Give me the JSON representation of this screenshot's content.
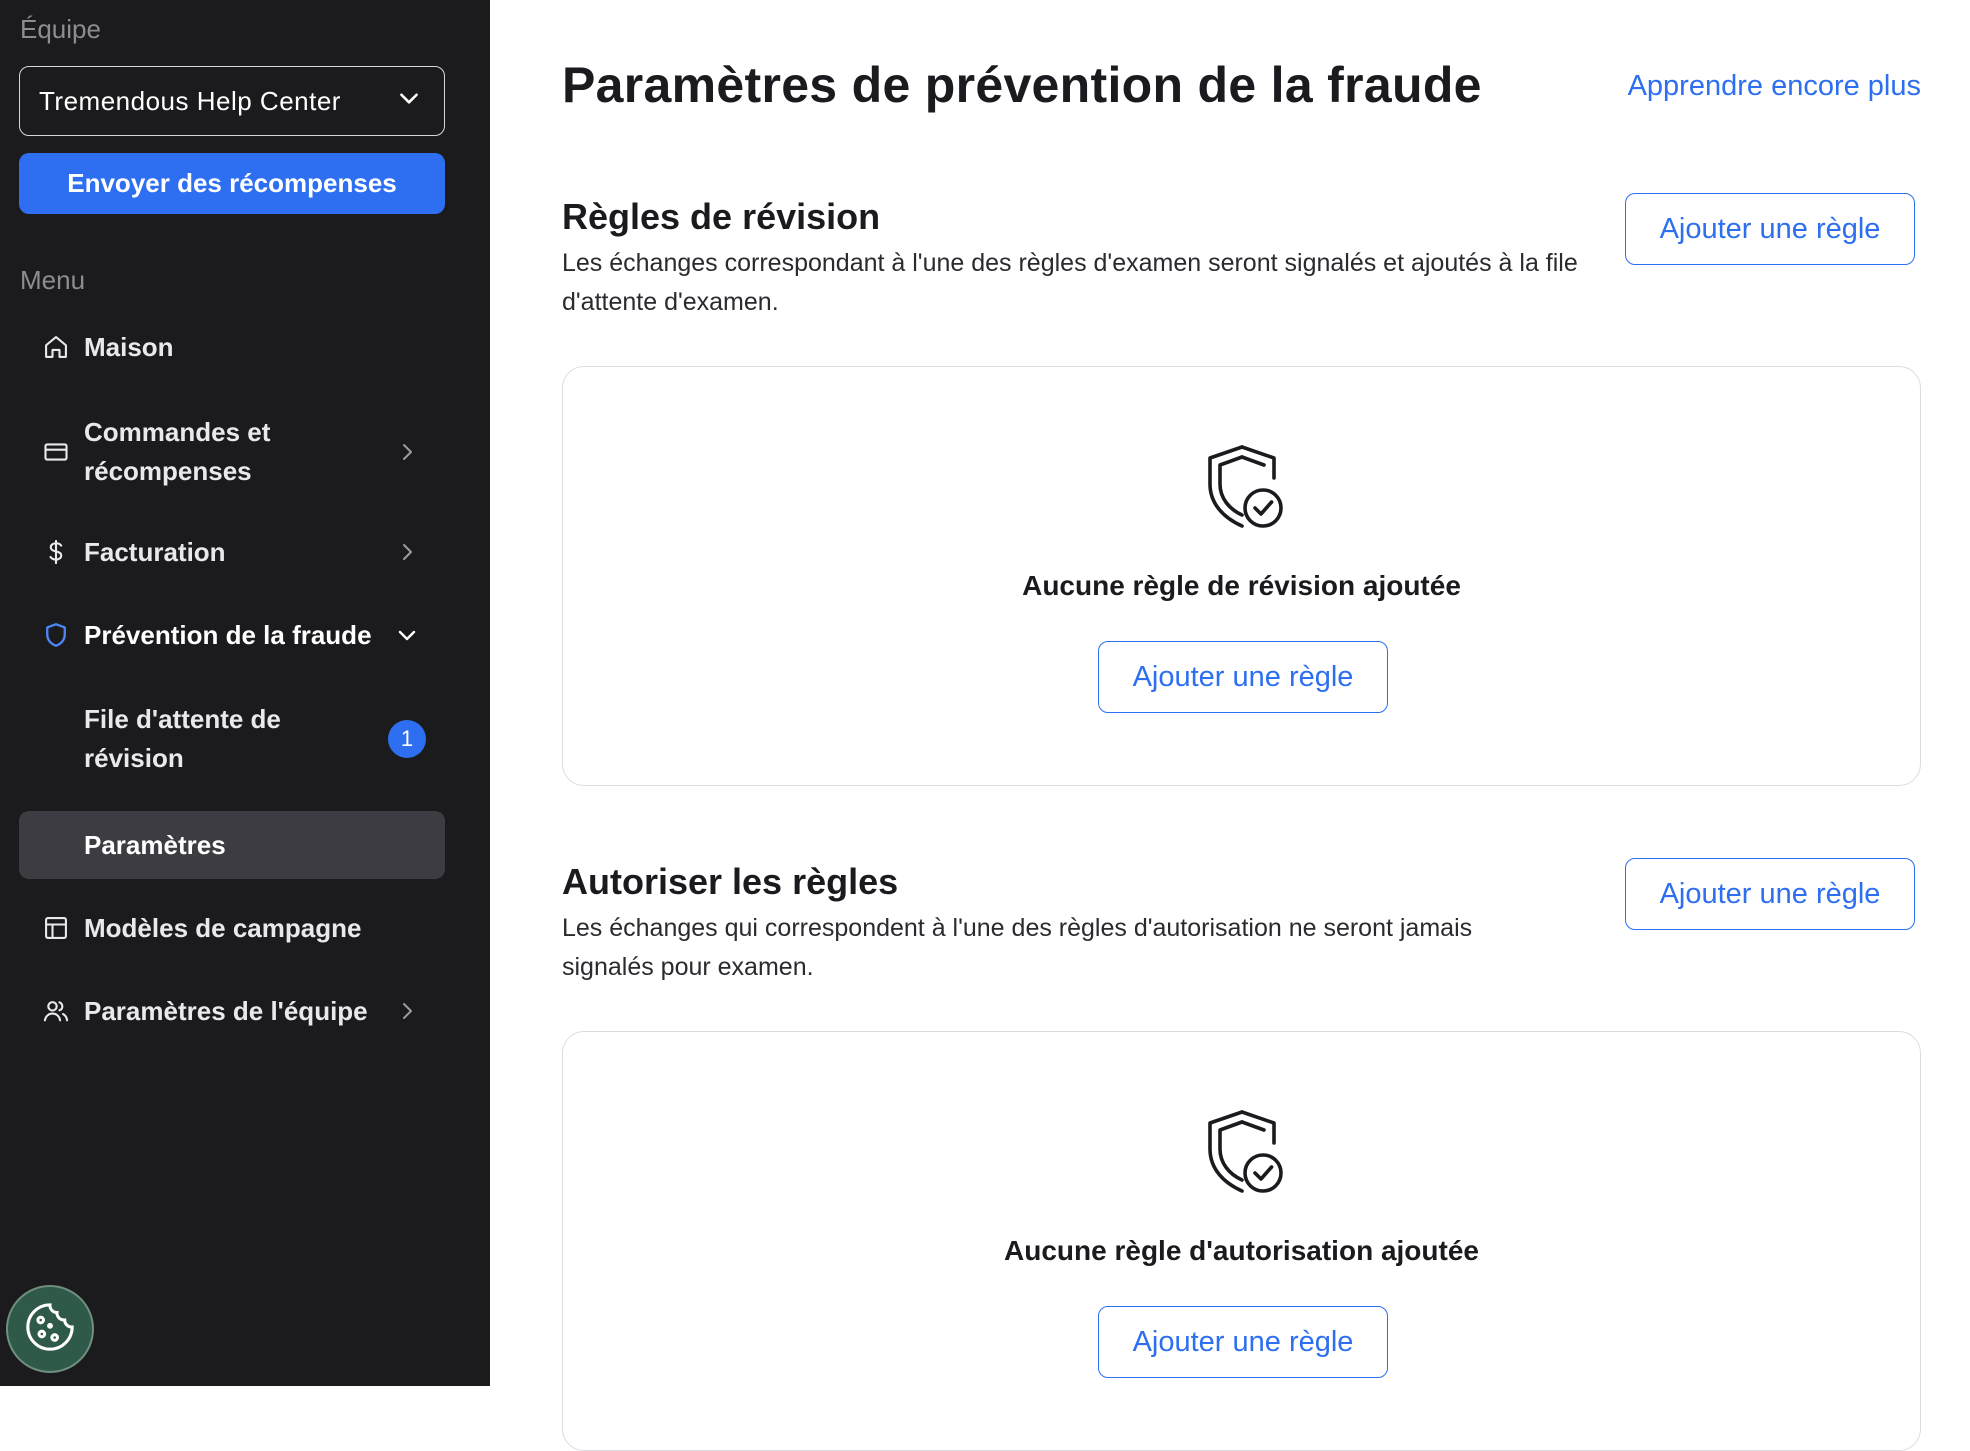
{
  "sidebar": {
    "team_label": "Équipe",
    "team_name": "Tremendous Help Center",
    "send_button": "Envoyer des récompenses",
    "menu_label": "Menu",
    "items": [
      {
        "label": "Maison",
        "icon": "home-icon"
      },
      {
        "label": "Commandes et récompenses",
        "icon": "card-icon"
      },
      {
        "label": "Facturation",
        "icon": "dollar-icon"
      },
      {
        "label": "Prévention de la fraude",
        "icon": "shield-icon"
      },
      {
        "label": "File d'attente de révision",
        "badge": "1"
      },
      {
        "label": "Paramètres"
      },
      {
        "label": "Modèles de campagne",
        "icon": "template-icon"
      },
      {
        "label": "Paramètres de l'équipe",
        "icon": "users-icon"
      }
    ],
    "cookie_icon": "cookie-icon"
  },
  "main": {
    "title": "Paramètres de prévention de la fraude",
    "learn_more": "Apprendre encore plus",
    "review_rules": {
      "title": "Règles de révision",
      "description": "Les échanges correspondant à l'une des règles d'examen seront signalés et ajoutés à la file d'attente d'examen.",
      "add_button": "Ajouter une règle",
      "empty_text": "Aucune règle de révision ajoutée",
      "empty_button": "Ajouter une règle"
    },
    "allow_rules": {
      "title": "Autoriser les règles",
      "description": "Les échanges qui correspondent à l'une des règles d'autorisation ne seront jamais signalés pour examen.",
      "add_button": "Ajouter une règle",
      "empty_text": "Aucune règle d'autorisation ajoutée",
      "empty_button": "Ajouter une règle"
    }
  },
  "colors": {
    "sidebar_bg": "#1b1b1e",
    "accent": "#2d6ff0",
    "active_item_bg": "#3c3c42",
    "cookie_bg": "#2f5a49"
  }
}
